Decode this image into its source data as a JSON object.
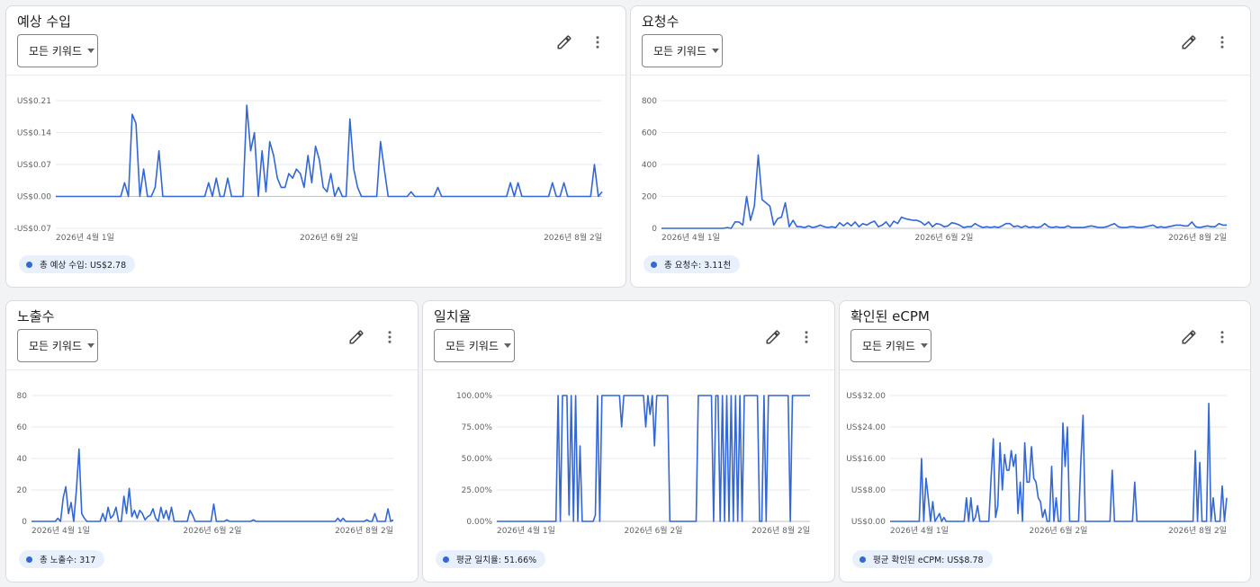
{
  "colors": {
    "series": "#3367d6",
    "grid": "#e8eaed",
    "axis": "#bdc1c6"
  },
  "icons": {
    "edit": "pencil-icon",
    "more": "more-vert-icon"
  },
  "cards": [
    {
      "id": "revenue",
      "title": "예상 수입",
      "dropdown": "모든 키워드",
      "chip": "총 예상 수입: US$2.78",
      "chart_data": {
        "type": "line",
        "x_tick_labels": [
          "2026년 4월 1일",
          "2026년 6월 2일",
          "2026년 8월 2일"
        ],
        "y_tick_labels": [
          "-US$0.07",
          "US$0.00",
          "US$0.07",
          "US$0.14",
          "US$0.21"
        ],
        "ylim": [
          -0.07,
          0.21
        ],
        "baseline_tick": 0,
        "values": [
          0,
          0,
          0,
          0,
          0,
          0,
          0,
          0,
          0,
          0,
          0,
          0,
          0,
          0,
          0,
          0,
          0,
          0,
          0.03,
          0,
          0.18,
          0.16,
          0,
          0.06,
          0,
          0,
          0.02,
          0.1,
          0,
          0,
          0,
          0,
          0,
          0,
          0,
          0,
          0,
          0,
          0,
          0,
          0.03,
          0,
          0.04,
          0,
          0,
          0.04,
          0,
          0,
          0,
          0,
          0.2,
          0.1,
          0.14,
          0,
          0.1,
          0.01,
          0.12,
          0.09,
          0.04,
          0.02,
          0.02,
          0.05,
          0.04,
          0.06,
          0.05,
          0.02,
          0.09,
          0.03,
          0.11,
          0.08,
          0.02,
          0.01,
          0.05,
          0,
          0.02,
          0,
          0,
          0.17,
          0.06,
          0.02,
          0,
          0,
          0,
          0,
          0,
          0.12,
          0.06,
          0,
          0,
          0,
          0,
          0,
          0,
          0.01,
          0,
          0,
          0,
          0,
          0,
          0,
          0.02,
          0,
          0,
          0,
          0,
          0,
          0,
          0,
          0,
          0,
          0,
          0,
          0,
          0,
          0,
          0,
          0,
          0,
          0,
          0.03,
          0,
          0.03,
          0,
          0,
          0,
          0,
          0,
          0,
          0,
          0,
          0.03,
          0,
          0,
          0.03,
          0,
          0,
          0,
          0,
          0,
          0,
          0,
          0.07,
          0,
          0.01
        ]
      }
    },
    {
      "id": "requests",
      "title": "요청수",
      "dropdown": "모든 키워드",
      "chip": "총 요청수: 3.11천",
      "chart_data": {
        "type": "line",
        "x_tick_labels": [
          "2026년 4월 1일",
          "2026년 6월 2일",
          "2026년 8월 2일"
        ],
        "y_tick_labels": [
          "0",
          "200",
          "400",
          "600",
          "800"
        ],
        "ylim": [
          0,
          800
        ],
        "baseline_tick": 0,
        "values": [
          0,
          0,
          0,
          0,
          0,
          0,
          0,
          0,
          0,
          0,
          0,
          0,
          0,
          0,
          0,
          0,
          0,
          5,
          0,
          40,
          40,
          20,
          200,
          50,
          140,
          460,
          180,
          160,
          140,
          20,
          60,
          70,
          160,
          10,
          50,
          10,
          10,
          5,
          15,
          5,
          10,
          20,
          10,
          5,
          10,
          5,
          35,
          15,
          35,
          15,
          40,
          10,
          30,
          20,
          35,
          45,
          10,
          20,
          40,
          10,
          45,
          30,
          70,
          60,
          55,
          50,
          50,
          40,
          20,
          40,
          10,
          30,
          25,
          10,
          15,
          35,
          30,
          20,
          5,
          10,
          10,
          30,
          15,
          5,
          10,
          5,
          10,
          5,
          15,
          30,
          30,
          10,
          15,
          5,
          15,
          5,
          10,
          5,
          10,
          30,
          10,
          5,
          10,
          5,
          5,
          15,
          5,
          5,
          5,
          5,
          10,
          15,
          10,
          5,
          5,
          10,
          20,
          30,
          10,
          5,
          5,
          10,
          10,
          5,
          5,
          10,
          15,
          20,
          5,
          10,
          5,
          10,
          15,
          20,
          20,
          15,
          15,
          40,
          10,
          5,
          10,
          15,
          10,
          10,
          30,
          20,
          20
        ]
      }
    },
    {
      "id": "impressions",
      "title": "노출수",
      "dropdown": "모든 키워드",
      "chip": "총 노출수: 317",
      "chart_data": {
        "type": "line",
        "x_tick_labels": [
          "2026년 4월 1일",
          "2026년 6월 2일",
          "2026년 8월 2일"
        ],
        "y_tick_labels": [
          "0",
          "20",
          "40",
          "60",
          "80"
        ],
        "ylim": [
          0,
          80
        ],
        "baseline_tick": 0,
        "values": [
          0,
          0,
          0,
          0,
          0,
          0,
          0,
          0,
          0,
          0,
          2,
          0,
          15,
          22,
          5,
          12,
          0,
          20,
          46,
          5,
          2,
          0,
          0,
          0,
          0,
          0,
          0,
          5,
          0,
          9,
          2,
          4,
          9,
          0,
          0,
          16,
          5,
          21,
          3,
          7,
          2,
          7,
          5,
          1,
          3,
          4,
          8,
          2,
          0,
          9,
          2,
          7,
          1,
          9,
          0,
          0,
          0,
          0,
          0,
          0,
          7,
          4,
          0,
          0,
          0,
          0,
          0,
          0,
          0,
          11,
          0,
          0,
          0,
          0,
          1,
          0,
          0,
          0,
          0,
          0,
          0,
          0,
          0,
          0,
          1,
          0,
          0,
          0,
          0,
          0,
          0,
          0,
          0,
          0,
          0,
          0,
          0,
          0,
          0,
          0,
          0,
          0,
          0,
          0,
          0,
          0,
          0,
          0,
          0,
          0,
          0,
          0,
          0,
          0,
          0,
          0,
          2,
          0,
          2,
          0,
          0,
          0,
          0,
          0,
          0,
          0,
          0,
          1,
          0,
          0,
          5,
          0,
          0,
          0,
          0,
          8,
          0,
          1
        ]
      }
    },
    {
      "id": "match-rate",
      "title": "일치율",
      "dropdown": "모든 키워드",
      "chip": "평균 일치율: 51.66%",
      "chart_data": {
        "type": "line",
        "x_tick_labels": [
          "2026년 4월 1일",
          "2026년 6월 2일",
          "2026년 8월 2일"
        ],
        "y_tick_labels": [
          "0.00%",
          "25.00%",
          "50.00%",
          "75.00%",
          "100.00%"
        ],
        "ylim": [
          0,
          100
        ],
        "baseline_tick": 0,
        "values": [
          0,
          0,
          0,
          0,
          0,
          0,
          0,
          0,
          0,
          0,
          0,
          0,
          0,
          0,
          0,
          0,
          0,
          0,
          0,
          0,
          0,
          0,
          0,
          0,
          0,
          0,
          0,
          0,
          100,
          0,
          100,
          100,
          100,
          5,
          100,
          0,
          100,
          0,
          60,
          0,
          0,
          0,
          0,
          0,
          0,
          5,
          100,
          0,
          100,
          100,
          100,
          100,
          100,
          100,
          100,
          100,
          100,
          75,
          100,
          100,
          100,
          100,
          100,
          100,
          100,
          100,
          100,
          100,
          75,
          100,
          85,
          100,
          60,
          100,
          100,
          100,
          100,
          100,
          100,
          0,
          0,
          0,
          0,
          0,
          0,
          0,
          0,
          0,
          0,
          0,
          0,
          0,
          100,
          100,
          100,
          100,
          100,
          100,
          100,
          0,
          100,
          100,
          0,
          100,
          0,
          100,
          0,
          100,
          0,
          100,
          0,
          100,
          0,
          100,
          100,
          100,
          100,
          100,
          100,
          100,
          0,
          0,
          100,
          0,
          100,
          100,
          100,
          100,
          100,
          100,
          100,
          100,
          100,
          100,
          0,
          100,
          100,
          100,
          100,
          100,
          100,
          100,
          100,
          100
        ]
      }
    },
    {
      "id": "ecpm",
      "title": "확인된 eCPM",
      "dropdown": "모든 키워드",
      "chip": "평균 확인된 eCPM: US$8.78",
      "chart_data": {
        "type": "line",
        "x_tick_labels": [
          "2026년 4월 1일",
          "2026년 6월 2일",
          "2026년 8월 2일"
        ],
        "y_tick_labels": [
          "US$0.00",
          "US$8.00",
          "US$16.00",
          "US$24.00",
          "US$32.00"
        ],
        "ylim": [
          0,
          32
        ],
        "baseline_tick": 0,
        "values": [
          0,
          0,
          0,
          0,
          0,
          0,
          0,
          0,
          0,
          0,
          0,
          0,
          0,
          0,
          16,
          0,
          11,
          6,
          0,
          5,
          0,
          1,
          2,
          0,
          1,
          0,
          0,
          0,
          0,
          0,
          0,
          0,
          0,
          0,
          6,
          0,
          6,
          0,
          1,
          4,
          0,
          0,
          0,
          0,
          0,
          11,
          21,
          1,
          4,
          20,
          8,
          17,
          13,
          13,
          18,
          14,
          17,
          2,
          10,
          0,
          20,
          10,
          10,
          19,
          11,
          10,
          6,
          5,
          1,
          3,
          0,
          0,
          14,
          0,
          6,
          0,
          0,
          25,
          14,
          24,
          0,
          0,
          0,
          0,
          0,
          15,
          27,
          0,
          0,
          0,
          0,
          0,
          0,
          0,
          0,
          0,
          0,
          0,
          0,
          13,
          0,
          0,
          0,
          0,
          0,
          0,
          0,
          0,
          0,
          10,
          0,
          0,
          0,
          0,
          0,
          0,
          0,
          0,
          0,
          0,
          0,
          0,
          0,
          0,
          0,
          0,
          0,
          0,
          0,
          0,
          0,
          0,
          0,
          0,
          0,
          0,
          18,
          0,
          15,
          0,
          0,
          0,
          30,
          0,
          6,
          0,
          0,
          0,
          9,
          0,
          6
        ]
      }
    }
  ]
}
